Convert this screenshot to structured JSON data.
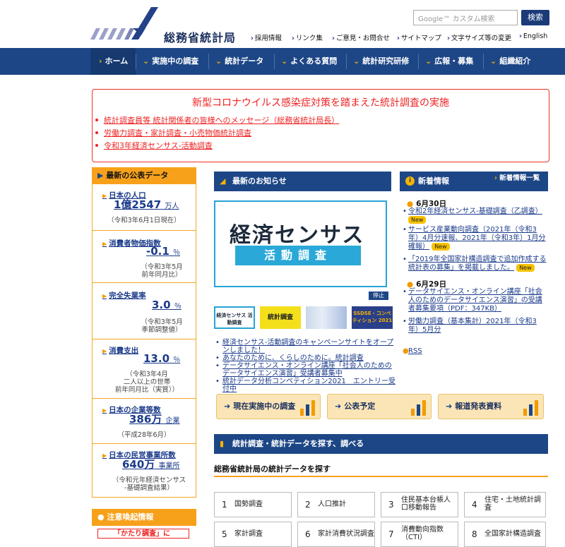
{
  "header": {
    "site_name": "総務省統計局",
    "search_placeholder": "Google™ カスタム検索",
    "search_button": "検索",
    "util_links": [
      "採用情報",
      "リンク集",
      "ご意見・お問合せ",
      "サイトマップ",
      "文字サイズ等の変更",
      "English"
    ]
  },
  "nav": {
    "items": [
      "ホーム",
      "実施中の調査",
      "統計データ",
      "よくある質問",
      "統計研究研修",
      "広報・募集",
      "組織紹介"
    ]
  },
  "alert": {
    "title": "新型コロナウイルス感染症対策を踏まえた統計調査の実施",
    "links": [
      "統計調査員等 統計関係者の皆様へのメッセージ（総務省統計局長）",
      "労働力調査・家計調査・小売物価統計調査",
      "令和3年経済センサス-活動調査"
    ]
  },
  "stats": {
    "header": "最新の公表データ",
    "items": [
      {
        "label": "日本の人口",
        "value": "1億2547",
        "unit": "万人",
        "note": [
          "（令和3年6月1日現在）"
        ]
      },
      {
        "label": "消費者物価指数",
        "value": "-0.1",
        "unit": "％",
        "note": [
          "（令和3年5月",
          "前年同月比）"
        ]
      },
      {
        "label": "完全失業率",
        "value": "3.0",
        "unit": "％",
        "note": [
          "（令和3年5月",
          "季節調整値）"
        ]
      },
      {
        "label": "消費支出",
        "value": "13.0",
        "unit": "％",
        "note": [
          "（令和3年4月",
          "二人以上の世帯",
          "前年同月比（実質））"
        ]
      },
      {
        "label": "日本の企業等数",
        "value": "386万",
        "unit": "企業",
        "note": [
          "（平成28年6月）"
        ]
      },
      {
        "label": "日本の民営事業所数",
        "value": "640万",
        "unit": "事業所",
        "note": [
          "（令和元年経済センサス",
          "-基礎調査結果）"
        ]
      }
    ],
    "warning_header": "注意喚起情報",
    "warning_text": "「かたり調査」に"
  },
  "news": {
    "header": "最新のお知らせ",
    "banner_top": "経済センサス",
    "banner_bottom": "活動調査",
    "stop_label": "停止",
    "thumbs": [
      "経済センサス 活動調査",
      "統計調査",
      "",
      "SSDSE・コンペティション 2021"
    ],
    "items": [
      "経済センサス-活動調査のキャンペーンサイトをオープンしました！",
      "あなたのために、くらしのために。統計調査",
      "データサイエンス・オンライン講座「社会人のためのデータサイエンス演習」受講者募集中",
      "統計データ分析コンペティション2021　エントリー受付中"
    ]
  },
  "buttons": [
    "現在実施中の調査",
    "公表予定",
    "報道発表資料"
  ],
  "search_section": {
    "header": "統計調査・統計データを探す、調べる",
    "sub": "総務省統計局の統計データを探す",
    "categories": [
      {
        "num": "1",
        "label": "国勢調査"
      },
      {
        "num": "2",
        "label": "人口推計"
      },
      {
        "num": "3",
        "label": "住民基本台帳人口移動報告"
      },
      {
        "num": "4",
        "label": "住宅・土地統計調査"
      },
      {
        "num": "5",
        "label": "家計調査"
      },
      {
        "num": "6",
        "label": "家計消費状況調査"
      },
      {
        "num": "7",
        "label": "消費動向指数（CTI）"
      },
      {
        "num": "8",
        "label": "全国家計構造調査"
      }
    ]
  },
  "whatsnew": {
    "header": "新着情報",
    "list_link": "新着情報一覧",
    "new_badge": "New",
    "dates": [
      "6月30日",
      "6月29日"
    ],
    "items": [
      "令和2年経済センサス-基礎調査（乙調査）",
      "サービス産業動向調査（2021年（令和3年）4月分速報、2021年（令和3年）1月分確報）",
      "「2019年全国家計構造調査で追加作成する統計表の募集」を掲載しました。",
      "データサイエンス・オンライン講座「社会人のためのデータサイエンス演習」の受講者募集要項（PDF：347KB）",
      "労働力調査（基本集計）2021年（令和3年）5月分"
    ],
    "rss": "RSS"
  },
  "colors": {
    "navy": "#1d4686",
    "orange": "#f7a11a",
    "alert_red": "#e22222"
  }
}
